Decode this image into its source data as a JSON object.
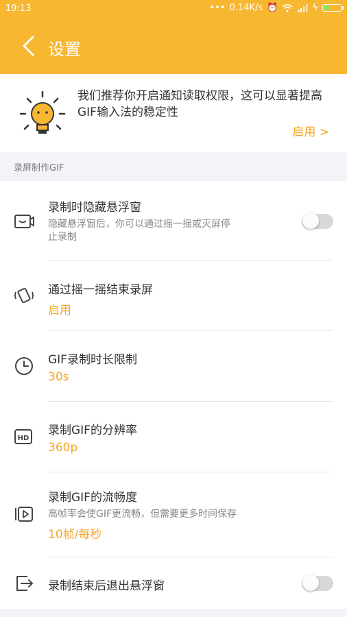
{
  "status_bar": {
    "time": "19:13",
    "net_speed": "0.14K/s"
  },
  "header": {
    "title": "设置"
  },
  "banner": {
    "message": "我们推荐你开启通知读取权限，这可以显著提高GIF输入法的稳定性",
    "action": "启用 >"
  },
  "section": {
    "title": "录屏制作GIF"
  },
  "settings": [
    {
      "title": "录制时隐藏悬浮窗",
      "desc_line1": "隐藏悬浮窗后，你可以通过摇一摇或灭屏停",
      "desc_line2": "止录制",
      "toggle": false,
      "icon": "screen-record-icon"
    },
    {
      "title": "通过摇一摇结束录屏",
      "value": "启用",
      "icon": "shake-phone-icon"
    },
    {
      "title": "GIF录制时长限制",
      "value": "30s",
      "icon": "clock-icon"
    },
    {
      "title": "录制GIF的分辨率",
      "value": "360p",
      "icon": "hd-icon"
    },
    {
      "title": "录制GIF的流畅度",
      "desc": "高帧率会使GIF更流畅，但需要更多时间保存",
      "value": "10帧/每秒",
      "icon": "play-frames-icon"
    },
    {
      "title": "录制结束后退出悬浮窗",
      "toggle": false,
      "icon": "exit-icon"
    }
  ],
  "colors": {
    "accent": "#f7b731",
    "value_orange": "#f5a623"
  }
}
